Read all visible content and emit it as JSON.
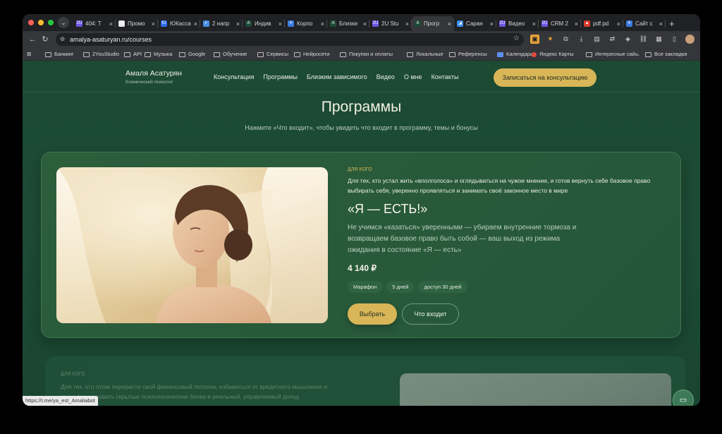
{
  "browser": {
    "tabs": [
      {
        "label": "404: Т",
        "color": "#6c55e0",
        "glyph": "2U",
        "active": false
      },
      {
        "label": "Промо",
        "color": "#e8e8e8",
        "glyph": "◎",
        "active": false
      },
      {
        "label": "ЮКасса",
        "color": "#2b6de8",
        "glyph": "Ю",
        "active": false
      },
      {
        "label": "2 напр",
        "color": "#4a90e2",
        "glyph": "◐",
        "active": false
      },
      {
        "label": "Индив",
        "color": "#1e4a35",
        "glyph": "A",
        "active": false
      },
      {
        "label": "Корпо",
        "color": "#3a7be0",
        "glyph": "✕",
        "active": false
      },
      {
        "label": "Близки",
        "color": "#1e4a35",
        "glyph": "A",
        "active": false
      },
      {
        "label": "2U Stu",
        "color": "#6c55e0",
        "glyph": "2U",
        "active": false
      },
      {
        "label": "Прогр",
        "color": "#1e4a35",
        "glyph": "A",
        "active": true
      },
      {
        "label": "Саран",
        "color": "#3a8ee8",
        "glyph": "◢",
        "active": false
      },
      {
        "label": "Видео",
        "color": "#6c55e0",
        "glyph": "2U",
        "active": false
      },
      {
        "label": "CRM 2",
        "color": "#6c55e0",
        "glyph": "2U",
        "active": false
      },
      {
        "label": "pdf.pd",
        "color": "#d93b2b",
        "glyph": "▲",
        "active": false
      },
      {
        "label": "Сайт с",
        "color": "#3a7be0",
        "glyph": "✕",
        "active": false
      }
    ],
    "tab_close": "×",
    "new_tab": "+",
    "url": "amalya-asaturyan.ru/courses",
    "bookmarks": [
      "Банкинг",
      "2YouStudio",
      "API",
      "Музыка",
      "Google",
      "Обучение",
      "Сервисы",
      "Нейросети",
      "Покупки и оплаты",
      "Локальные",
      "Референсы",
      "Календарь",
      "Яндекс Карты",
      "Интересные сай..."
    ],
    "bookmarks_more": "»",
    "all_bookmarks": "Все закладки",
    "status_link": "https://t.me/ya_est_Amaliabot"
  },
  "site": {
    "brand_name": "Амаля Асатурян",
    "brand_sub": "Клинический психолог",
    "menu": [
      "Консультация",
      "Программы",
      "Близким зависимого",
      "Видео",
      "О мне",
      "Контакты"
    ],
    "cta": "Записаться на консультацию",
    "title": "Программы",
    "subtitle": "Нажмите «Что входит», чтобы увидеть что входит в программу, темы и бонусы"
  },
  "course": {
    "tag": "ДЛЯ КОГО",
    "for_whom": "Для тех, кто устал жить «вполголоса» и оглядываться на чужое мнение, и готов вернуть себе базовое право выбирать себя, уверенно проявляться и занимать своё законное место в мире",
    "name": "«Я — ЕСТЬ!»",
    "description": "Не учимся «казаться» уверенными — убираем внутренние тормоза и возвращаем базовое право быть собой — ваш выход из режима ожидания в состояние «Я — есть»",
    "price": "4 140 ₽",
    "chips": [
      "Марафон",
      "5 дней",
      "доступ 30 дней"
    ],
    "choose": "Выбрать",
    "whats_inside": "Что входит"
  },
  "course2": {
    "tag": "ДЛЯ КОГО",
    "for_whom": "Для тех, кто готов перерасти свой финансовый потолок, избавиться от кредитного мышления и трансформировать скрытые психологические блоки в реальный, управляемый доход"
  }
}
